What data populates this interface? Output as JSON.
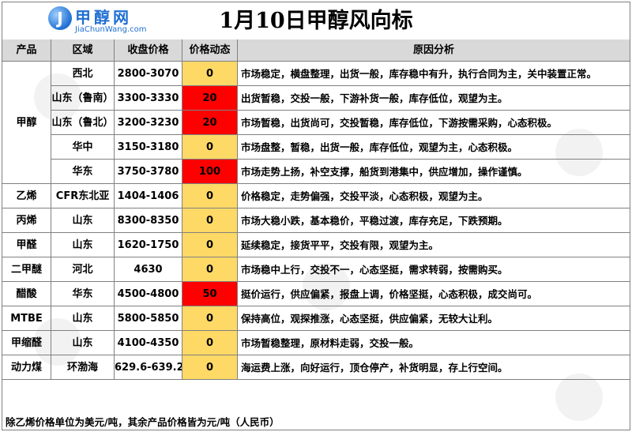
{
  "logo": {
    "mark": "J",
    "name": "甲醇网",
    "url": "JiaChunWang.com"
  },
  "title": "1月10日甲醇风向标",
  "headers": {
    "product": "产品",
    "region": "区域",
    "price": "收盘价格",
    "dynamic": "价格动态",
    "reason": "原因分析"
  },
  "products": [
    {
      "name": "甲醇",
      "rows": [
        {
          "region": "西北",
          "price": "2800-3070",
          "dynamic": "0",
          "up": false,
          "reason": "市场稳定，横盘整理，出货一般，库存稳中有升，执行合同为主，关中装置正常。"
        },
        {
          "region": "山东（鲁南）",
          "price": "3300-3330",
          "dynamic": "20",
          "up": true,
          "reason": "出货暂稳，交投一般，下游补货一般，库存低位，观望为主。"
        },
        {
          "region": "山东（鲁北）",
          "price": "3200-3230",
          "dynamic": "20",
          "up": true,
          "reason": "市场暂稳，出货尚可，交投暂稳，库存低位，下游按需采购，心态积极。"
        },
        {
          "region": "华中",
          "price": "3150-3180",
          "dynamic": "0",
          "up": false,
          "reason": "市场盘整，暂稳，出货一般，库存低位，观望为主，心态积极。"
        },
        {
          "region": "华东",
          "price": "3750-3780",
          "dynamic": "100",
          "up": true,
          "reason": "市场走势上扬，补空支撑，船货到港集中，供应增加，操作谨慎。"
        }
      ]
    },
    {
      "name": "乙烯",
      "rows": [
        {
          "region": "CFR东北亚",
          "price": "1404-1406",
          "dynamic": "0",
          "up": false,
          "reason": "价格稳定，走势偏强，交投平淡，心态积极，观望为主。"
        }
      ]
    },
    {
      "name": "丙烯",
      "rows": [
        {
          "region": "山东",
          "price": "8300-8350",
          "dynamic": "0",
          "up": false,
          "reason": "市场大稳小跌，基本稳价，平稳过渡，库存充足，下跌预期。"
        }
      ]
    },
    {
      "name": "甲醛",
      "rows": [
        {
          "region": "山东",
          "price": "1620-1750",
          "dynamic": "0",
          "up": false,
          "reason": "延续稳定，接货平平，交投有限，观望为主。"
        }
      ]
    },
    {
      "name": "二甲醚",
      "rows": [
        {
          "region": "河北",
          "price": "4630",
          "dynamic": "0",
          "up": false,
          "reason": "市场稳中上行，交投不一，心态坚挺，需求转弱，按需购买。"
        }
      ]
    },
    {
      "name": "醋酸",
      "rows": [
        {
          "region": "华东",
          "price": "4500-4800",
          "dynamic": "50",
          "up": true,
          "reason": "挺价运行，供应偏紧，报盘上调，价格坚挺，心态积极，成交尚可。"
        }
      ]
    },
    {
      "name": "MTBE",
      "rows": [
        {
          "region": "山东",
          "price": "5800-5850",
          "dynamic": "0",
          "up": false,
          "reason": "保持高位，观探推涨，心态坚挺，供应偏紧，无较大让利。"
        }
      ]
    },
    {
      "name": "甲缩醛",
      "rows": [
        {
          "region": "山东",
          "price": "4100-4350",
          "dynamic": "0",
          "up": false,
          "reason": "市场暂稳整理，原材料走弱，交投一般。"
        }
      ]
    },
    {
      "name": "动力煤",
      "rows": [
        {
          "region": "环渤海",
          "price": "629.6-639.2",
          "dynamic": "0",
          "up": false,
          "reason": "海运费上涨，向好运行，顶仓停产，补货明显，存上行空间。"
        }
      ]
    }
  ],
  "footnote": "除乙烯价格单位为美元/吨，其余产品价格皆为元/吨（人民币）",
  "colors": {
    "header_bg": "#d9d9d9",
    "dynamic_flat": "#ffd966",
    "dynamic_up": "#ff0000",
    "border": "#808080",
    "logo_blue": "#1f6fd2"
  }
}
